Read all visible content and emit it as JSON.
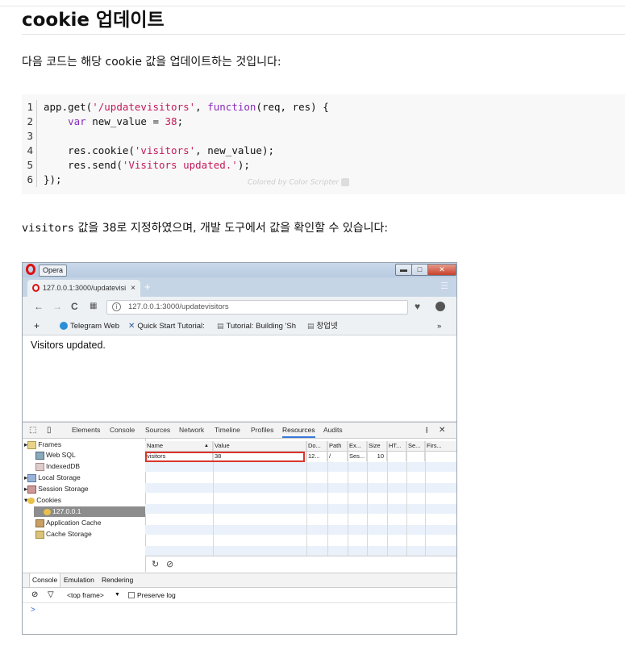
{
  "heading": "cookie 업데이트",
  "intro": "다음 코드는 해당 cookie 값을 업데이트하는 것입니다:",
  "code": {
    "line_numbers": [
      "1",
      "2",
      "3",
      "4",
      "5",
      "6"
    ],
    "l1_a": "app.get(",
    "l1_str": "'/updatevisitors'",
    "l1_b": ", ",
    "l1_kw": "function",
    "l1_c": "(req, res) {",
    "l2_kw": "var",
    "l2_a": " new_value = ",
    "l2_num": "38",
    "l2_b": ";",
    "l4_a": "res.cookie(",
    "l4_str": "'visitors'",
    "l4_b": ", new_value);",
    "l5_a": "res.send(",
    "l5_str": "'Visitors updated.'",
    "l5_b": ");",
    "l6": "});",
    "credit": "Colored by Color Scripter"
  },
  "para2_mono": "visitors",
  "para2_rest": " 값을 38로 지정하였으며, 개발 도구에서 값을 확인할 수 있습니다:",
  "screenshot": {
    "opera_label": "Opera",
    "tab_title": "127.0.0.1:3000/updatevisi",
    "tab_close": "×",
    "new_tab": "+",
    "url": "127.0.0.1:3000/updatevisitors",
    "bookmarks": {
      "plus": "+",
      "telegram": "Telegram Web",
      "quick_start": "Quick Start Tutorial:",
      "tutorial": "Tutorial: Building 'Sh",
      "korean": "창업넷",
      "more": "»"
    },
    "page_message": "Visitors updated.",
    "devtools": {
      "panels": [
        "Elements",
        "Console",
        "Sources",
        "Network",
        "Timeline",
        "Profiles",
        "Resources",
        "Audits"
      ],
      "selected_panel": "Resources",
      "tree": [
        "Frames",
        "Web SQL",
        "IndexedDB",
        "Local Storage",
        "Session Storage",
        "Cookies",
        "127.0.0.1",
        "Application Cache",
        "Cache Storage"
      ],
      "columns": [
        "Name",
        "Value",
        "Do...",
        "Path",
        "Ex...",
        "Size",
        "HT...",
        "Se...",
        "Firs..."
      ],
      "row": [
        "visitors",
        "38",
        "12...",
        "/",
        "Ses...",
        "10",
        "",
        "",
        ""
      ],
      "console_tabs": [
        "Console",
        "Emulation",
        "Rendering"
      ],
      "frame_select": "<top frame>",
      "preserve_log": "Preserve log",
      "prompt": ">"
    }
  }
}
